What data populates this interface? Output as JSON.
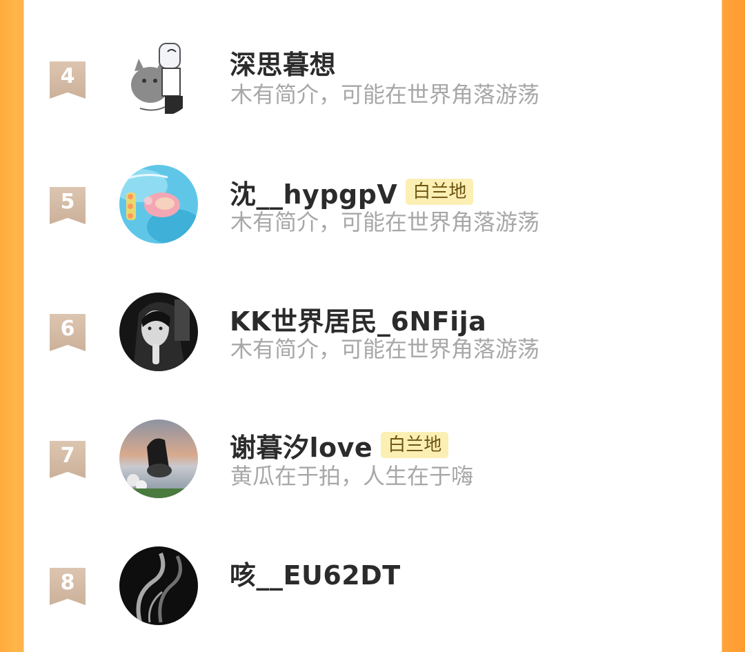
{
  "ranking": {
    "rows": [
      {
        "rank": "4",
        "name": "深思暮想",
        "tag": "",
        "bio": "木有简介，可能在世界角落游荡",
        "avatar_desc": "cartoon-cat-sketch"
      },
      {
        "rank": "5",
        "name": "沈__hypgpV",
        "tag": "白兰地",
        "bio": "木有简介，可能在世界角落游荡",
        "avatar_desc": "pool-float"
      },
      {
        "rank": "6",
        "name": "KK世界居民_6NFija",
        "tag": "",
        "bio": "木有简介，可能在世界角落游荡",
        "avatar_desc": "dark-portrait"
      },
      {
        "rank": "7",
        "name": "谢暮汐love",
        "tag": "白兰地",
        "bio": "黄瓜在于拍，人生在于嗨",
        "avatar_desc": "sunset-girl"
      },
      {
        "rank": "8",
        "name": "咳__EU62DT",
        "tag": "",
        "bio": "",
        "avatar_desc": "black-smoke"
      }
    ]
  },
  "colors": {
    "accent": "#ffa43a",
    "badge": "#d5bca6",
    "tag_bg": "#fbefb4",
    "tag_text": "#6e5410",
    "name_text": "#2b2b2b",
    "bio_text": "#a7a7a7"
  }
}
